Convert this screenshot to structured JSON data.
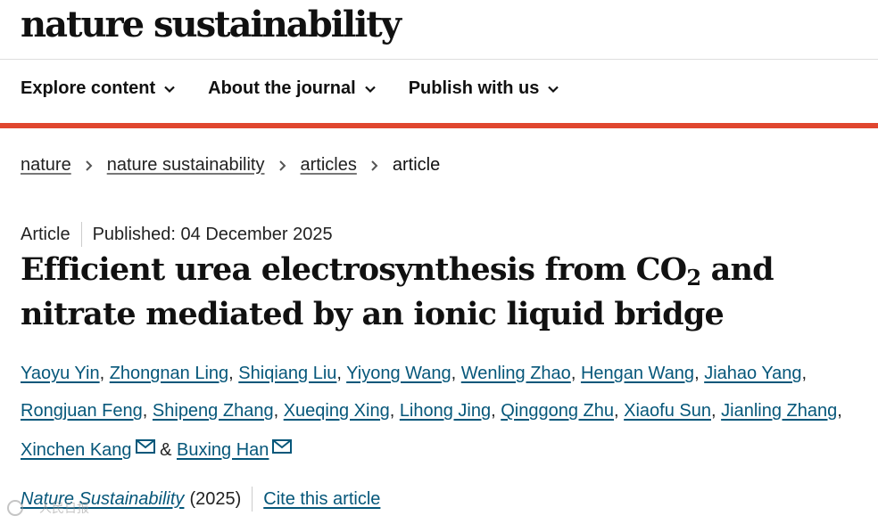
{
  "header": {
    "logo_text": "nature sustainability"
  },
  "nav": {
    "items": [
      {
        "label": "Explore content"
      },
      {
        "label": "About the journal"
      },
      {
        "label": "Publish with us"
      }
    ]
  },
  "breadcrumb": {
    "items": [
      "nature",
      "nature sustainability",
      "articles"
    ],
    "current": "article"
  },
  "article": {
    "type": "Article",
    "published": "Published: 04 December 2025",
    "title_part1": "Efficient urea electrosynthesis from CO",
    "title_sub": "2",
    "title_part2": " and nitrate mediated by an ionic liquid bridge",
    "authors": [
      "Yaoyu Yin",
      "Zhongnan Ling",
      "Shiqiang Liu",
      "Yiyong Wang",
      "Wenling Zhao",
      "Hengan Wang",
      "Jiahao Yang",
      "Rongjuan Feng",
      "Shipeng Zhang",
      "Xueqing Xing",
      "Lihong Jing",
      "Qinggong Zhu",
      "Xiaofu Sun",
      "Jianling Zhang",
      "Xinchen Kang",
      "Buxing Han"
    ],
    "author_separator": ", ",
    "author_last_join": " & ",
    "journal": "Nature Sustainability",
    "year": "(2025)",
    "cite_label": "Cite this article"
  },
  "watermark": {
    "text": "人民日报"
  },
  "colors": {
    "accent_red": "#e0462f",
    "link_blue": "#06577a"
  },
  "icons": {
    "nav_chevron": "chevron-down-icon",
    "crumb_sep": "chevron-right-icon",
    "email": "email-icon"
  }
}
